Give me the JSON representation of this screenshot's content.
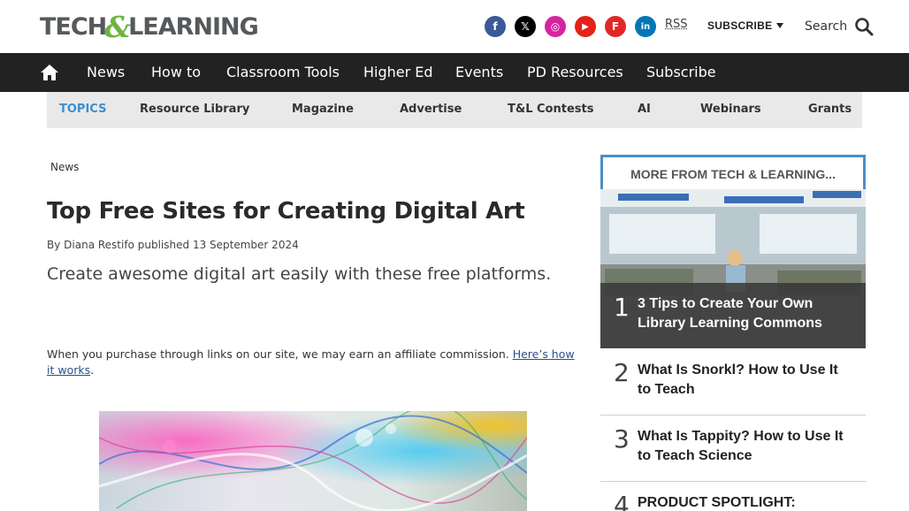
{
  "header": {
    "logo_left": "TECH",
    "logo_amp": "&",
    "logo_right": "LEARNING",
    "social": [
      {
        "name": "facebook",
        "glyph": "f",
        "color": "#3b5998"
      },
      {
        "name": "x",
        "glyph": "𝕏",
        "color": "#000000"
      },
      {
        "name": "instagram",
        "glyph": "◎",
        "color": "#d6249f"
      },
      {
        "name": "youtube",
        "glyph": "▶",
        "color": "#e62117"
      },
      {
        "name": "flipboard",
        "glyph": "F",
        "color": "#e12828"
      },
      {
        "name": "linkedin",
        "glyph": "in",
        "color": "#0077b5"
      }
    ],
    "rss_label": "RSS",
    "subscribe_label": "SUBSCRIBE",
    "search_label": "Search"
  },
  "nav": {
    "items": [
      "News",
      "How to",
      "Classroom Tools",
      "Higher Ed",
      "Events",
      "PD Resources",
      "Subscribe"
    ]
  },
  "topics": {
    "label": "TOPICS",
    "items": [
      "Resource Library",
      "Magazine",
      "Advertise",
      "T&L Contests",
      "AI",
      "Webinars",
      "Grants"
    ]
  },
  "article": {
    "breadcrumb": "News",
    "title": "Top Free Sites for Creating Digital Art",
    "byline_prefix": "By",
    "author": "Diana Restifo",
    "published_label": "published",
    "date": "13 September 2024",
    "strapline": "Create awesome digital art easily with these free platforms.",
    "affiliate_text": "When you purchase through links on our site, we may earn an affiliate commission.",
    "affiliate_link": "Here’s how it works",
    "affiliate_end": "."
  },
  "sidebar": {
    "heading": "MORE FROM TECH & LEARNING...",
    "items": [
      {
        "number": "1",
        "title": "3 Tips to Create Your Own Library Learning Commons"
      },
      {
        "number": "2",
        "title": "What Is Snorkl? How to Use It to Teach"
      },
      {
        "number": "3",
        "title": "What Is Tappity? How to Use It to Teach Science"
      },
      {
        "number": "4",
        "title": "PRODUCT SPOTLIGHT:"
      }
    ]
  },
  "colors": {
    "nav_bg": "#222222",
    "topics_bg": "#e9e9e9",
    "accent_blue": "#4a8ec9",
    "logo_green": "#6fb33f"
  }
}
